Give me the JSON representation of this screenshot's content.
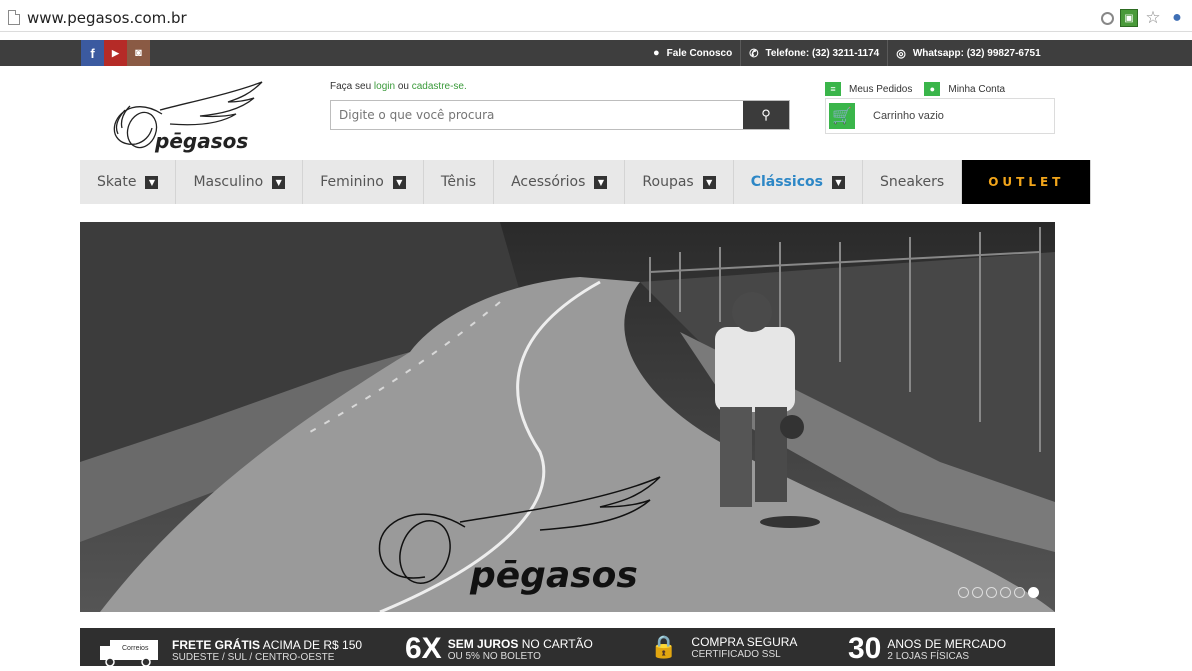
{
  "browser": {
    "url": "www.pegasos.com.br"
  },
  "topbar": {
    "social": [
      "facebook-icon",
      "youtube-icon",
      "instagram-icon"
    ],
    "links": [
      {
        "icon": "speech-bubble-icon",
        "label": "Fale Conosco"
      },
      {
        "icon": "phone-icon",
        "label": "Telefone: (32) 3211-1174"
      },
      {
        "icon": "whatsapp-icon",
        "label": "Whatsapp: (32) 99827-6751"
      }
    ]
  },
  "header": {
    "login_prefix": "Faça seu",
    "login_link": "login",
    "login_or": "ou",
    "register_link": "cadastre-se.",
    "search_placeholder": "Digite o que você procura",
    "my_orders": "Meus Pedidos",
    "my_account": "Minha Conta",
    "cart_text": "Carrinho vazio",
    "logo_text": "pēgasos"
  },
  "nav": {
    "items": [
      {
        "label": "Skate",
        "dropdown": true
      },
      {
        "label": "Masculino",
        "dropdown": true
      },
      {
        "label": "Feminino",
        "dropdown": true
      },
      {
        "label": "Tênis",
        "dropdown": false
      },
      {
        "label": "Acessórios",
        "dropdown": true
      },
      {
        "label": "Roupas",
        "dropdown": true
      },
      {
        "label": "Clássicos",
        "dropdown": true
      },
      {
        "label": "Sneakers",
        "dropdown": false
      },
      {
        "label": "OUTLET",
        "dropdown": false
      }
    ]
  },
  "hero": {
    "logo_text": "pēgasos",
    "slides": 6,
    "active_slide": 6
  },
  "infobar": {
    "frete_title": "FRETE GRÁTIS",
    "frete_rest": "ACIMA DE R$ 150",
    "frete_sub": "SUDESTE / SUL / CENTRO-OESTE",
    "correios": "Correios",
    "juros_big": "6X",
    "juros_title": "SEM JUROS",
    "juros_rest": "NO CARTÃO",
    "juros_sub": "OU 5% NO BOLETO",
    "compra_title": "COMPRA SEGURA",
    "compra_sub": "CERTIFICADO SSL",
    "anos_big": "30",
    "anos_title": "ANOS DE MERCADO",
    "anos_sub": "2 LOJAS FÍSICAS"
  },
  "colors": {
    "accent_green": "#3ab54a",
    "topbar": "#3e3e3e",
    "outlet_text": "#f2a51a",
    "classicos_blue": "#2d87c6"
  }
}
